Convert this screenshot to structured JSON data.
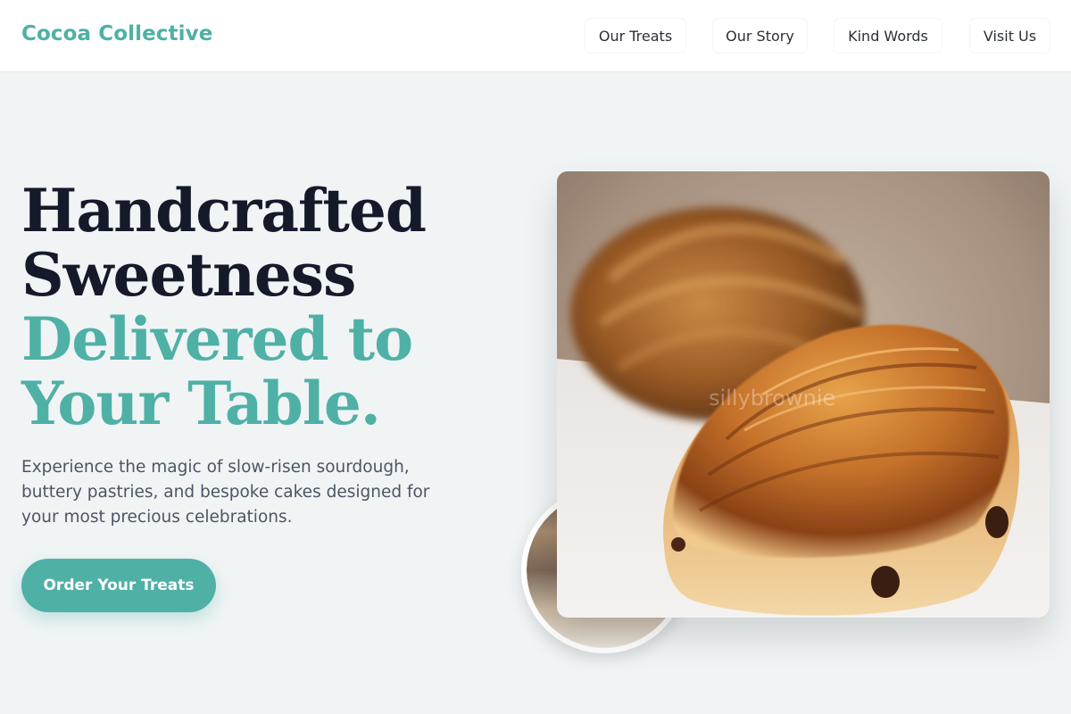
{
  "brand": {
    "name": "Cocoa Collective"
  },
  "nav": {
    "items": [
      {
        "label": "Our Treats"
      },
      {
        "label": "Our Story"
      },
      {
        "label": "Kind Words"
      },
      {
        "label": "Visit Us"
      }
    ]
  },
  "hero": {
    "headline_dark_1": "Handcrafted",
    "headline_dark_2": "Sweetness",
    "headline_teal_1": "Delivered to",
    "headline_teal_2": "Your Table.",
    "description": "Experience the magic of slow-risen sourdough, buttery pastries, and bespoke cakes designed for your most precious celebrations.",
    "cta_label": "Order Your Treats",
    "photo_watermark": "sillybrownie"
  },
  "colors": {
    "accent": "#4fb0a6",
    "heading": "#141a2a",
    "body_text": "#4b5563",
    "background": "#f0f4f5"
  }
}
